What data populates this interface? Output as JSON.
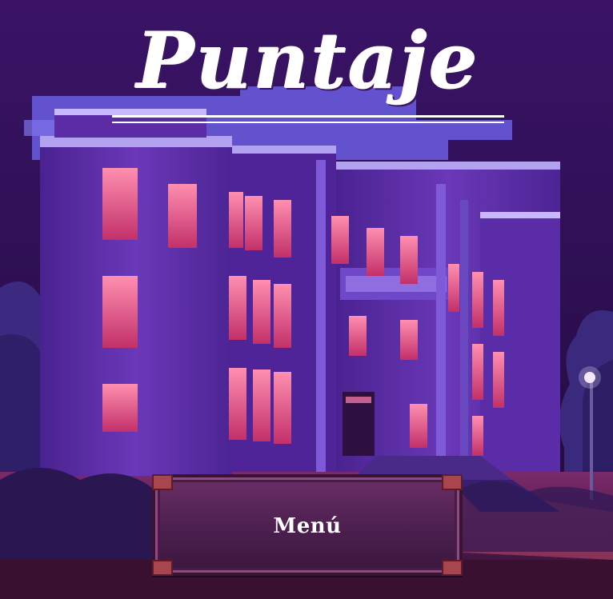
{
  "screen": {
    "title": "Puntaje",
    "menu_button_label": "Menú"
  },
  "colors": {
    "sky": "#2a0f4a",
    "building": "#5a2aa0",
    "window_glow": "#e05a8a",
    "button": "#5a2458",
    "title_text": "#ffffff"
  }
}
